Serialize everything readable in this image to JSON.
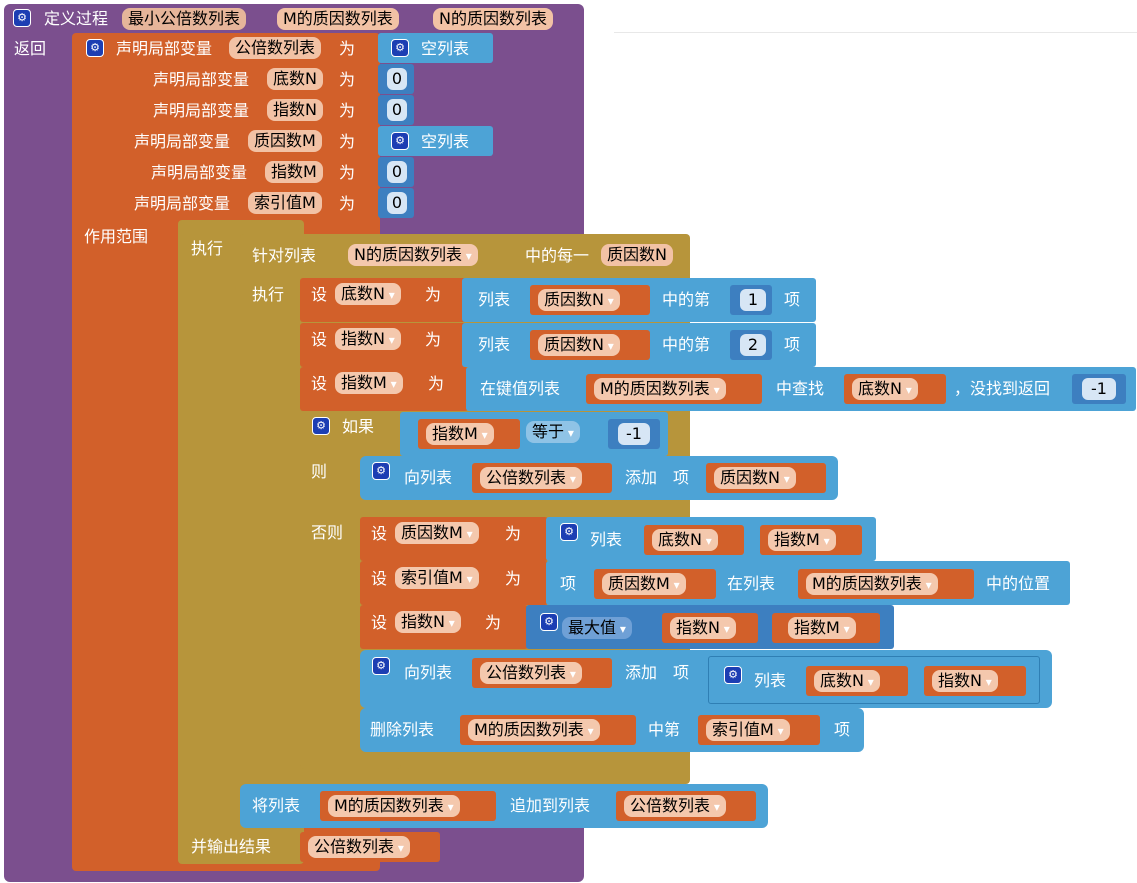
{
  "header": {
    "define": "定义过程",
    "proc_name": "最小公倍数列表",
    "param1": "M的质因数列表",
    "param2": "N的质因数列表"
  },
  "return_label": "返回",
  "locals": {
    "declare": "声明局部变量",
    "as": "为",
    "vars": [
      "公倍数列表",
      "底数N",
      "指数N",
      "质因数M",
      "指数M",
      "索引值M"
    ],
    "empty_list": "空列表",
    "zero": "0"
  },
  "scope": {
    "label": "作用范围",
    "exec": "执行",
    "output": "并输出结果",
    "output_var": "公倍数列表"
  },
  "foreach": {
    "label": "针对列表",
    "list": "N的质因数列表",
    "each": "中的每一",
    "item": "质因数N",
    "exec": "执行"
  },
  "set": {
    "label": "设",
    "as": "为"
  },
  "s1": {
    "var": "底数N",
    "list_label": "列表",
    "list": "质因数N",
    "nth": "中的第",
    "index": "1",
    "item": "项"
  },
  "s2": {
    "var": "指数N",
    "list_label": "列表",
    "list": "质因数N",
    "nth": "中的第",
    "index": "2",
    "item": "项"
  },
  "s3": {
    "var": "指数M",
    "lookup": "在键值列表",
    "list": "M的质因数列表",
    "find": "中查找",
    "key": "底数N",
    "notfound": "，没找到返回",
    "default": "-1"
  },
  "if": {
    "label": "如果",
    "var": "指数M",
    "op": "等于",
    "value": "-1",
    "then": "则",
    "else": "否则"
  },
  "then_add": {
    "to": "向列表",
    "list": "公倍数列表",
    "add": "添加",
    "item": "项",
    "value": "质因数N"
  },
  "e1": {
    "var": "质因数M",
    "list_label": "列表",
    "a": "底数N",
    "b": "指数M"
  },
  "e2": {
    "var": "索引值M",
    "item": "项",
    "value": "质因数M",
    "in_list": "在列表",
    "list": "M的质因数列表",
    "pos": "中的位置"
  },
  "e3": {
    "var": "指数N",
    "func": "最大值",
    "a": "指数N",
    "b": "指数M"
  },
  "e4": {
    "to": "向列表",
    "list": "公倍数列表",
    "add": "添加",
    "item": "项",
    "list_label": "列表",
    "a": "底数N",
    "b": "指数N"
  },
  "e5": {
    "remove": "删除列表",
    "list": "M的质因数列表",
    "nth": "中第",
    "index": "索引值M",
    "item": "项"
  },
  "append": {
    "label": "将列表",
    "list": "M的质因数列表",
    "to": "追加到列表",
    "target": "公倍数列表"
  }
}
